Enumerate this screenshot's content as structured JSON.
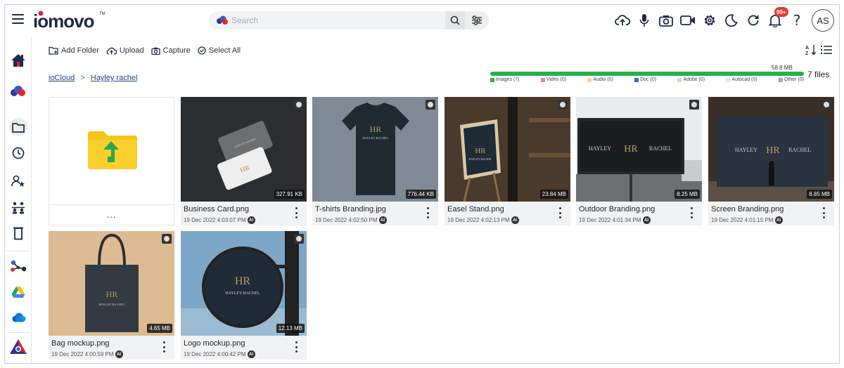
{
  "header": {
    "search_placeholder": "Search",
    "notification_count": "99+",
    "avatar_initials": "AS",
    "help_label": "?"
  },
  "toolbar": {
    "add_folder": "Add Folder",
    "upload": "Upload",
    "capture": "Capture",
    "select_all": "Select All"
  },
  "breadcrumb": {
    "root": "ioCloud",
    "separator": ">",
    "current": "Hayley rachel"
  },
  "storage": {
    "used": "58.8 MB",
    "files": "7 files",
    "fill_percent": 100,
    "legend": [
      {
        "label": "Images (7)",
        "color": "#27b24a"
      },
      {
        "label": "Video (0)",
        "color": "#f07ca0"
      },
      {
        "label": "Audio (0)",
        "color": "#f5d48a"
      },
      {
        "label": "Doc (0)",
        "color": "#2f6fd6"
      },
      {
        "label": "Adobe (0)",
        "color": "#c9d8f0"
      },
      {
        "label": "Autocad (0)",
        "color": "#f7dde6"
      },
      {
        "label": "Other (0)",
        "color": "#a8a8a8"
      }
    ]
  },
  "folder_card": {
    "more": "..."
  },
  "files": [
    {
      "name": "Business Card.png",
      "date": "19 Dec 2022 4:03:07 PM",
      "size": "327.91 KB",
      "ai": "AI"
    },
    {
      "name": "T-shirts Branding.jpg",
      "date": "19 Dec 2022 4:02:50 PM",
      "size": "776.44 KB",
      "ai": "AI"
    },
    {
      "name": "Easel Stand.png",
      "date": "19 Dec 2022 4:02:13 PM",
      "size": "23.84 MB",
      "ai": "AI"
    },
    {
      "name": "Outdoor Branding.png",
      "date": "19 Dec 2022 4:01:34 PM",
      "size": "8.25 MB",
      "ai": "AI"
    },
    {
      "name": "Screen Branding.png",
      "date": "19 Dec 2022 4:01:15 PM",
      "size": "8.85 MB",
      "ai": "AI"
    },
    {
      "name": "Bag mockup.png",
      "date": "19 Dec 2022 4:00:59 PM",
      "size": "4.65 MB",
      "ai": "AI"
    },
    {
      "name": "Logo mockup.png",
      "date": "19 Dec 2022 4:00:42 PM",
      "size": "12.13 MB",
      "ai": "AI"
    }
  ],
  "brand": {
    "logo_text": "iomovo",
    "tm": "TM",
    "accent": "#1b2b4b",
    "logo_red": "#e3262e"
  },
  "mockup_text": {
    "monogram": "HR",
    "first": "HAYLEY",
    "last": "RACHEL",
    "full": "HAYLEY RACHEL"
  }
}
